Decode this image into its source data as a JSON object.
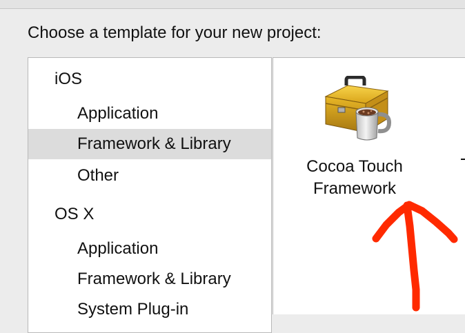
{
  "dialog": {
    "prompt": "Choose a template for your new project:"
  },
  "sidebar": {
    "sections": [
      {
        "platform": "iOS",
        "items": [
          "Application",
          "Framework & Library",
          "Other"
        ]
      },
      {
        "platform": "OS X",
        "items": [
          "Application",
          "Framework & Library",
          "System Plug-in"
        ]
      }
    ],
    "selected": "iOS / Framework & Library"
  },
  "templates": [
    {
      "label_line1": "Cocoa Touch",
      "label_line2": "Framework",
      "icon": "toolbox-with-coffee-cup-icon"
    }
  ],
  "annotation": {
    "icon": "red-hand-drawn-arrow-icon",
    "color": "#ff2a00"
  }
}
